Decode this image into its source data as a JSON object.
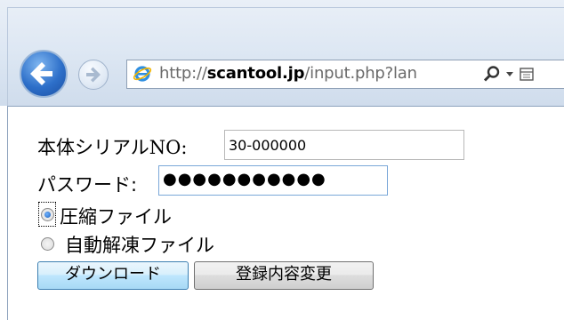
{
  "browser": {
    "url_prefix": "http://",
    "url_host": "scantool.jp",
    "url_rest": "/input.php?lan",
    "icons": {
      "back": "back-arrow-icon",
      "forward": "forward-arrow-icon",
      "site": "ie-logo-icon",
      "search": "search-icon",
      "dropdown": "dropdown-icon",
      "compat": "compatibility-view-icon"
    },
    "colors": {
      "back_button": "#2d6fc9",
      "chrome": "#dde7f3"
    }
  },
  "form": {
    "serial_label_prefix": "本体シリアル",
    "serial_label_suffix": "NO:",
    "serial_value": "30-000000",
    "password_label": "パスワード:",
    "password_value": "●●●●●●●●●●●",
    "radio_options": [
      {
        "label": "圧縮ファイル",
        "checked": true
      },
      {
        "label": "自動解凍ファイル",
        "checked": false
      }
    ],
    "download_button": "ダウンロード",
    "change_button": "登録内容変更"
  }
}
